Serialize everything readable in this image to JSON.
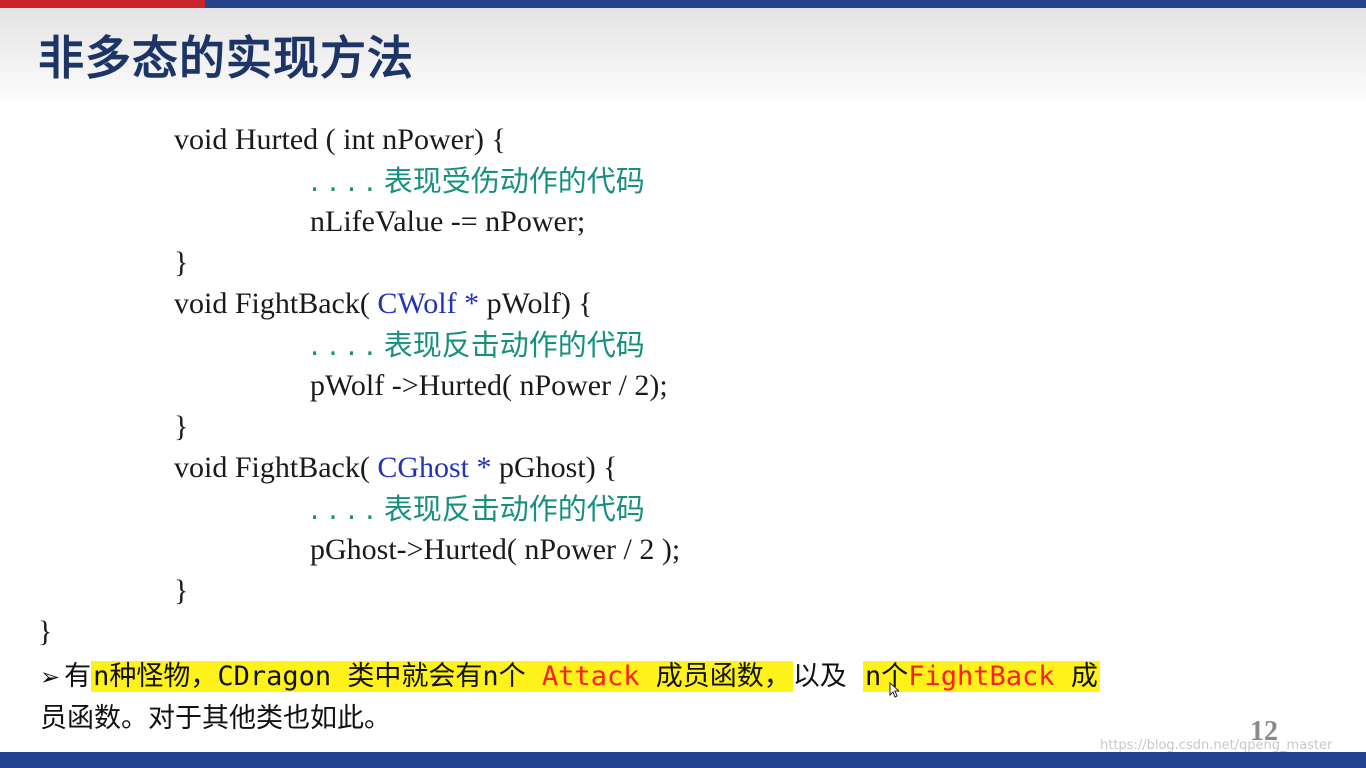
{
  "slide": {
    "title": "非多态的实现方法",
    "page_number": "12",
    "watermark": "https://blog.csdn.net/qpeng_master"
  },
  "code": {
    "l1": "void Hurted ( int nPower) {",
    "l2_dots": ". . . . ",
    "l2_comment": "表现受伤动作的代码",
    "l3": "nLifeValue -= nPower;",
    "l4": "}",
    "l5_pre": "void FightBack( ",
    "l5_type": "CWolf *",
    "l5_post": " pWolf) {",
    "l6_dots": ". . . . ",
    "l6_comment": "表现反击动作的代码",
    "l7": "pWolf ->Hurted( nPower / 2);",
    "l8": "}",
    "l9_pre": "void FightBack( ",
    "l9_type": "CGhost *",
    "l9_post": " pGhost) {",
    "l10_dots": ". . . . ",
    "l10_comment": "表现反击动作的代码",
    "l11": "pGhost->Hurted( nPower / 2 );",
    "l12": "}",
    "l13": "}"
  },
  "bullet": {
    "arrow": "➢",
    "p1": "有",
    "p2": "n种怪物，CDragon 类中就会有n个 ",
    "p3": "Attack",
    "p4": " 成员函数，",
    "p5": "以及 ",
    "p6": "n个",
    "p7": "FightBack",
    "p8": " 成",
    "line2": "员函数。对于其他类也如此。"
  },
  "colors": {
    "title": "#1c3566",
    "comment": "#17907f",
    "type": "#2233bb",
    "highlight": "#fff21a",
    "keyword_red": "#ff1e1e",
    "bar": "#25448f",
    "bar_accent": "#c8252d"
  },
  "icons": {
    "cursor": "mouse-pointer-icon"
  }
}
